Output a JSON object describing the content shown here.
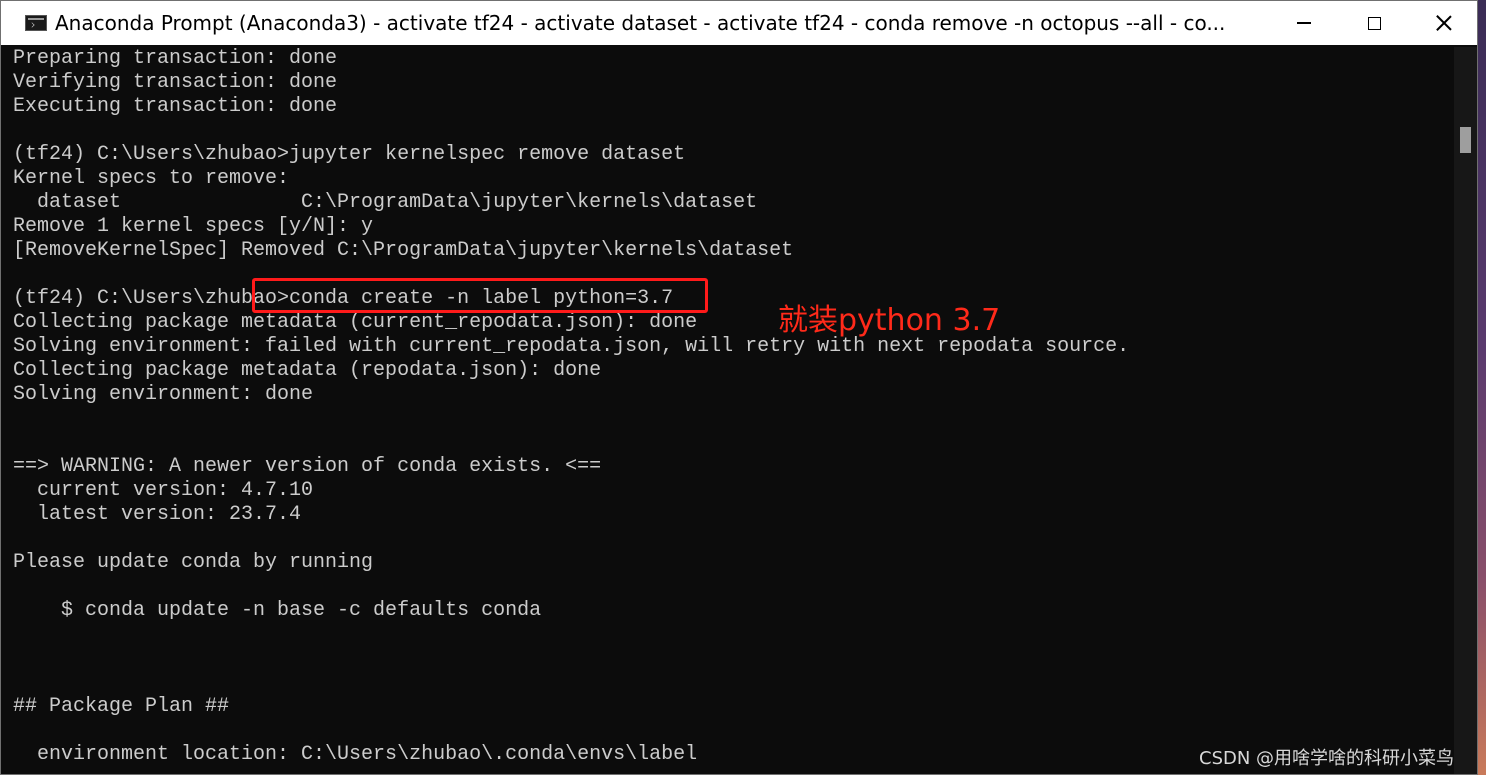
{
  "window": {
    "title": "Anaconda Prompt (Anaconda3) - activate  tf24 - activate  dataset - activate  tf24 - conda  remove -n octopus --all - co...",
    "app_icon": "terminal-icon",
    "controls": {
      "minimize": "minimize-icon",
      "maximize": "maximize-icon",
      "close": "close-icon"
    }
  },
  "console": {
    "lines": [
      "Preparing transaction: done",
      "Verifying transaction: done",
      "Executing transaction: done",
      "",
      "(tf24) C:\\Users\\zhubao>jupyter kernelspec remove dataset",
      "Kernel specs to remove:",
      "  dataset               C:\\ProgramData\\jupyter\\kernels\\dataset",
      "Remove 1 kernel specs [y/N]: y",
      "[RemoveKernelSpec] Removed C:\\ProgramData\\jupyter\\kernels\\dataset",
      "",
      "(tf24) C:\\Users\\zhubao>conda create -n label python=3.7",
      "Collecting package metadata (current_repodata.json): done",
      "Solving environment: failed with current_repodata.json, will retry with next repodata source.",
      "Collecting package metadata (repodata.json): done",
      "Solving environment: done",
      "",
      "",
      "==> WARNING: A newer version of conda exists. <==",
      "  current version: 4.7.10",
      "  latest version: 23.7.4",
      "",
      "Please update conda by running",
      "",
      "    $ conda update -n base -c defaults conda",
      "",
      "",
      "",
      "## Package Plan ##",
      "",
      "  environment location: C:\\Users\\zhubao\\.conda\\envs\\label"
    ]
  },
  "annotation": {
    "text": "就装python 3.7",
    "color": "#ff2a1a"
  },
  "watermark": "CSDN @用啥学啥的科研小菜鸟",
  "colors": {
    "console_bg": "#0c0c0c",
    "console_fg": "#cccccc",
    "highlight": "#ff1a1a"
  }
}
